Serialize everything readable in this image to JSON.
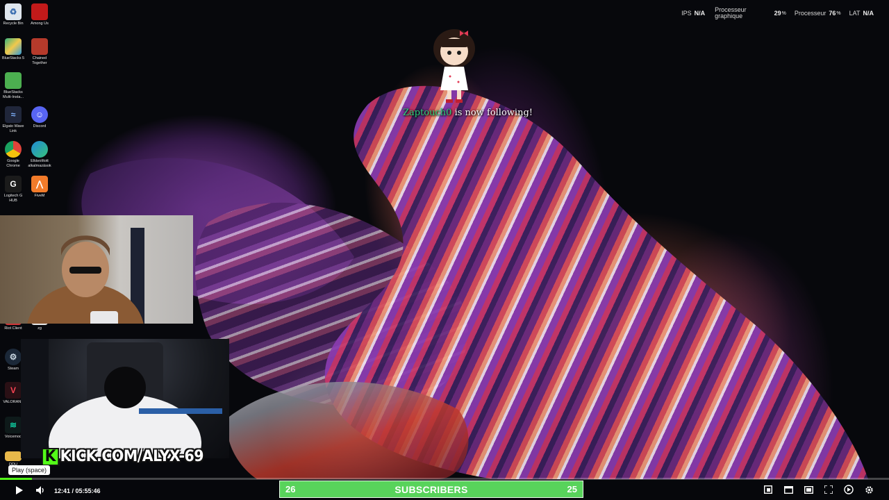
{
  "desktop": {
    "icons": [
      {
        "label": "Recycle Bin",
        "icon": "recycle-bin-icon",
        "color": "#dfe6ee"
      },
      {
        "label": "Among Us",
        "icon": "among-us-icon",
        "color": "#c21a1a"
      },
      {
        "label": "BlueStacks 5",
        "icon": "bluestacks-icon",
        "color": "#36b37e"
      },
      {
        "label": "Chained Together",
        "icon": "chained-together-icon",
        "color": "#b53a2b"
      },
      {
        "label": "BlueStacks Multi-Insta...",
        "icon": "bluestacks-multi-icon",
        "color": "#4caf50"
      },
      {
        "label": "Elgato Wave Link",
        "icon": "elgato-wave-link-icon",
        "color": "#20263a"
      },
      {
        "label": "Discord",
        "icon": "discord-icon",
        "color": "#5865f2"
      },
      {
        "label": "Google Chrome",
        "icon": "chrome-icon",
        "color": "#e0433a"
      },
      {
        "label": "Eltávolított alkalmazások",
        "icon": "edge-icon",
        "color": "#1f8ad8"
      },
      {
        "label": "Logitech G HUB",
        "icon": "logitech-ghub-icon",
        "color": "#1b1b1b"
      },
      {
        "label": "FiveM",
        "icon": "fivem-icon",
        "color": "#f27b2a"
      },
      {
        "label": "Riot Client",
        "icon": "riot-client-icon",
        "color": "#d13639"
      },
      {
        "label": "zg",
        "icon": "file-icon",
        "color": "#e8e8e8"
      },
      {
        "label": "Steam",
        "icon": "steam-icon",
        "color": "#1b2838"
      },
      {
        "label": "VALORANT",
        "icon": "valorant-icon",
        "color": "#fa4454"
      },
      {
        "label": "Voicemod",
        "icon": "voicemod-icon",
        "color": "#0ecfa1"
      },
      {
        "label": "DDU",
        "icon": "folder-icon",
        "color": "#e8b84a"
      }
    ]
  },
  "stats": {
    "ips_label": "IPS",
    "ips_value": "N/A",
    "gpu_label_1": "Processeur",
    "gpu_label_2": "graphique",
    "gpu_value": "29",
    "gpu_unit": "%",
    "cpu_label": "Processeur",
    "cpu_value": "76",
    "cpu_unit": "%",
    "lat_label": "LAT",
    "lat_value": "N/A"
  },
  "alert": {
    "username": "Zaptouch0",
    "message": " is now following!"
  },
  "overlay": {
    "kick_k": "K",
    "kick_url": "KICK.COM/ALYX-69"
  },
  "subscribers": {
    "left_count": "26",
    "title": "SUBSCRIBERS",
    "right_count": "25"
  },
  "player": {
    "tooltip": "Play (space)",
    "time": "12:41 / 05:55:46",
    "progress": 0.036,
    "accent_color": "#53fc18"
  }
}
